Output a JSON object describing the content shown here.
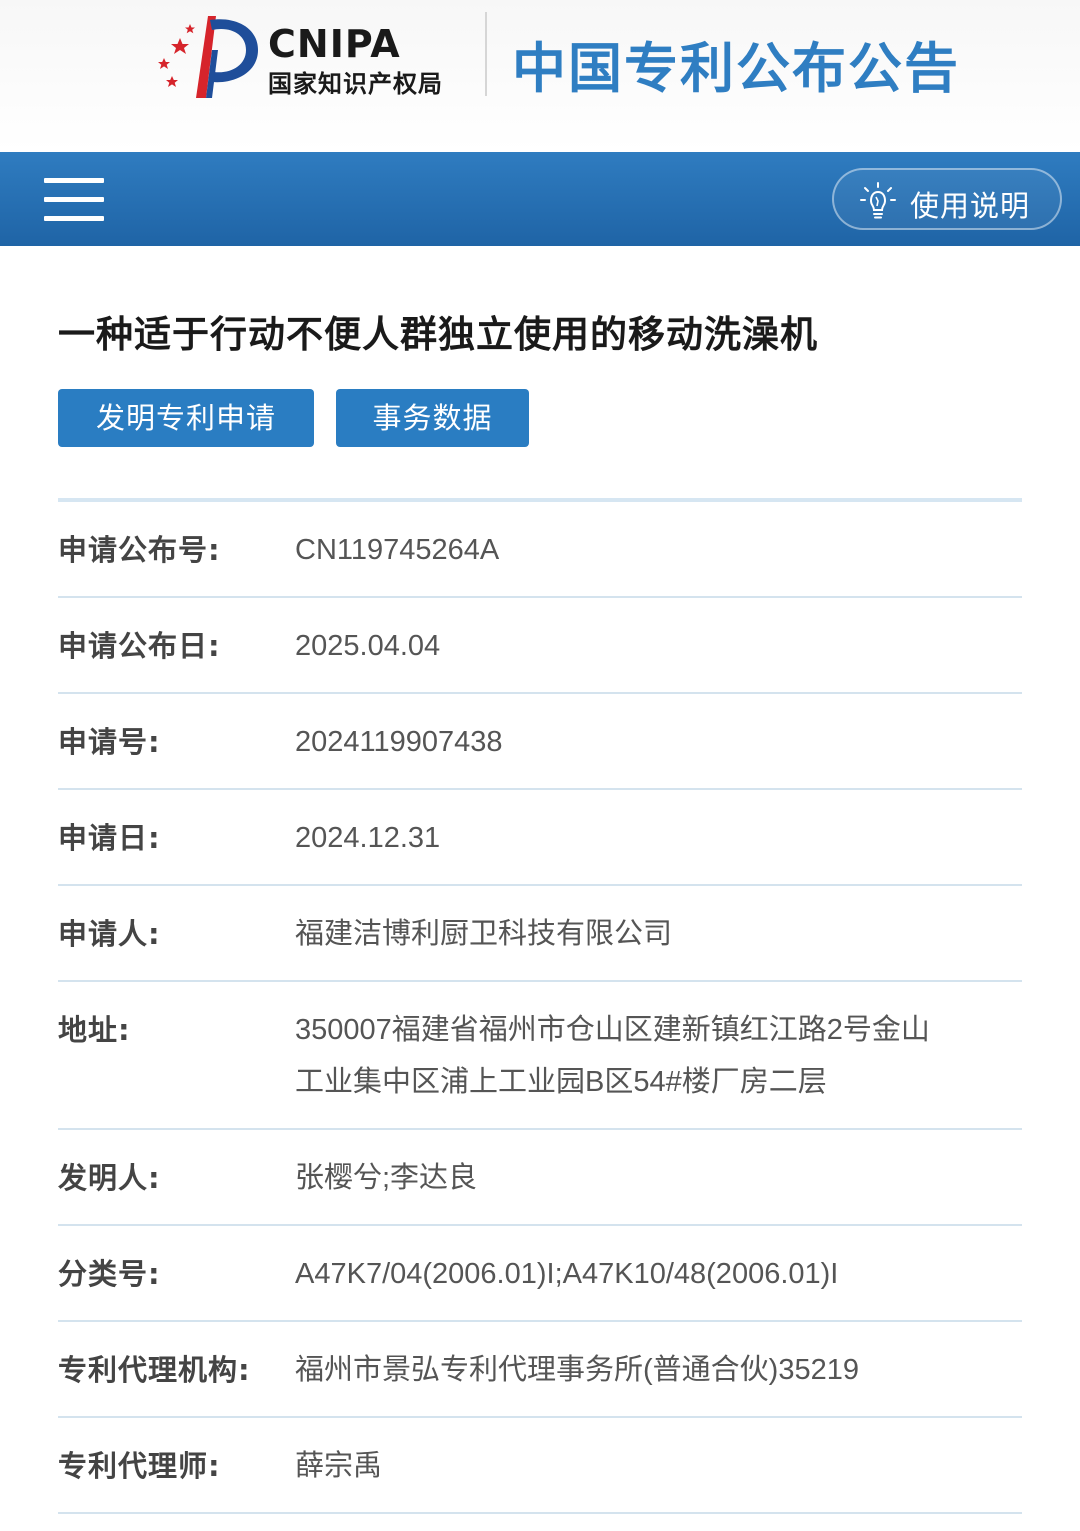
{
  "header": {
    "logo_en": "CNIPA",
    "logo_cn": "国家知识产权局",
    "site_title": "中国专利公布公告"
  },
  "nav": {
    "menu_icon": "hamburger-menu-icon",
    "help_icon": "lightbulb-icon",
    "help_label": "使用说明"
  },
  "patent": {
    "title": "一种适于行动不便人群独立使用的移动洗澡机",
    "tabs": [
      "发明专利申请",
      "事务数据"
    ]
  },
  "details": [
    {
      "label": "申请公布号:",
      "value": "CN119745264A"
    },
    {
      "label": "申请公布日:",
      "value": "2025.04.04"
    },
    {
      "label": "申请号:",
      "value": "2024119907438"
    },
    {
      "label": "申请日:",
      "value": "2024.12.31"
    },
    {
      "label": "申请人:",
      "value": "福建洁博利厨卫科技有限公司"
    },
    {
      "label": "地址:",
      "value_lines": [
        "350007福建省福州市仓山区建新镇红江路2号金山",
        "工业集中区浦上工业园B区54#楼厂房二层"
      ]
    },
    {
      "label": "发明人:",
      "value": "张樱兮;李达良"
    },
    {
      "label": "分类号:",
      "value": "A47K7/04(2006.01)I;A47K10/48(2006.01)I"
    },
    {
      "label": "专利代理机构:",
      "value": "福州市景弘专利代理事务所(普通合伙)35219"
    },
    {
      "label": "专利代理师:",
      "value": "薛宗禹"
    }
  ],
  "colors": {
    "brand_blue": "#2f7ec2",
    "nav_blue": "#1f64a6",
    "logo_red": "#d6242b"
  }
}
